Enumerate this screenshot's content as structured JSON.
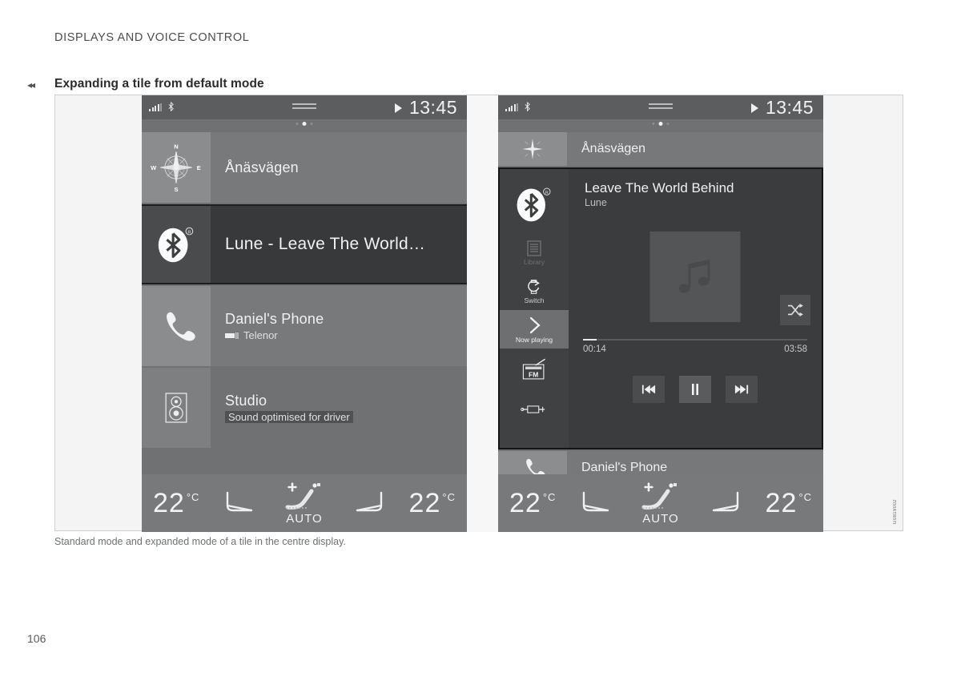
{
  "document": {
    "running_head": "DISPLAYS AND VOICE CONTROL",
    "section_heading": "Expanding a tile from default mode",
    "back_arrow": "◂◂",
    "page_number": "106",
    "figure_caption": "Standard mode and expanded mode of a tile in the centre display.",
    "figure_code": "G0819002"
  },
  "status_bar": {
    "time": "13:45",
    "icons": {
      "signal": "signal-bars-icon",
      "bluetooth": "bluetooth-icon",
      "media_play": "play-triangle-icon",
      "drag_handle": "drag-handle-icon"
    },
    "page_dots": [
      false,
      true,
      false
    ]
  },
  "left_display": {
    "name": "Standard mode",
    "tiles": [
      {
        "id": "navigation",
        "icon": "compass-rose-icon",
        "compass_labels": {
          "n": "N",
          "e": "E",
          "s": "S",
          "w": "W"
        },
        "title": "Ånäsvägen",
        "subtitle": "",
        "selected": false
      },
      {
        "id": "media",
        "icon": "bluetooth-icon",
        "title": "Lune - Leave The World…",
        "subtitle": "",
        "selected": true
      },
      {
        "id": "phone",
        "icon": "phone-handset-icon",
        "title": "Daniel's Phone",
        "subtitle": "Telenor",
        "subtitle_icon": "phone-signal-icon",
        "selected": false
      },
      {
        "id": "sound",
        "icon": "speaker-icon",
        "title": "Studio",
        "subtitle": "Sound optimised for driver",
        "selected": false
      }
    ]
  },
  "right_display": {
    "name": "Expanded mode",
    "collapsed_top": {
      "id": "navigation",
      "icon": "compass-small-icon",
      "title": "Ånäsvägen"
    },
    "expanded_tile": {
      "id": "media",
      "icon": "bluetooth-icon",
      "track_title": "Leave The World Behind",
      "artist": "Lune",
      "album_art_icon": "music-note-icon",
      "shuffle_icon": "shuffle-icon",
      "progress": {
        "elapsed": "00:14",
        "total": "03:58",
        "percent": 6
      },
      "transport": [
        {
          "id": "previous",
          "icon": "skip-back-icon",
          "active": false
        },
        {
          "id": "pause",
          "icon": "pause-icon",
          "active": true
        },
        {
          "id": "next",
          "icon": "skip-forward-icon",
          "active": false
        }
      ],
      "rail": [
        {
          "id": "library",
          "label": "Library",
          "icon": "list-icon",
          "state": "dimmed"
        },
        {
          "id": "switch",
          "label": "Switch",
          "icon": "switch-source-icon",
          "state": "normal"
        },
        {
          "id": "now-playing",
          "label": "Now playing",
          "icon": "chevron-right-icon",
          "state": "selected"
        },
        {
          "id": "fm",
          "label": "",
          "icon": "fm-radio-icon",
          "state": "normal"
        },
        {
          "id": "aux",
          "label": "",
          "icon": "aux-connector-icon",
          "state": "normal"
        }
      ]
    },
    "collapsed_bottom": {
      "id": "phone",
      "icon": "phone-handset-icon",
      "title": "Daniel's Phone"
    }
  },
  "climate_bar": {
    "left_temperature": "22",
    "left_unit": "°C",
    "right_temperature": "22",
    "right_unit": "°C",
    "auto_label": "AUTO",
    "icons": {
      "left_seat": "seat-heating-icon",
      "centre": "fan-auto-seat-icon",
      "right_seat": "seat-heating-icon"
    }
  },
  "colors": {
    "display_bg": "#6f7173",
    "tile_bg": "#77797b",
    "tile_selected_bg": "#38393b",
    "icon_box_bg": "#8a8c8e",
    "status_bar_bg": "#5b5d5f",
    "text_primary": "#f1f1f1",
    "text_secondary": "#d8d8d8",
    "page_bg": "#ffffff",
    "figure_bg": "#f4f4f4"
  }
}
